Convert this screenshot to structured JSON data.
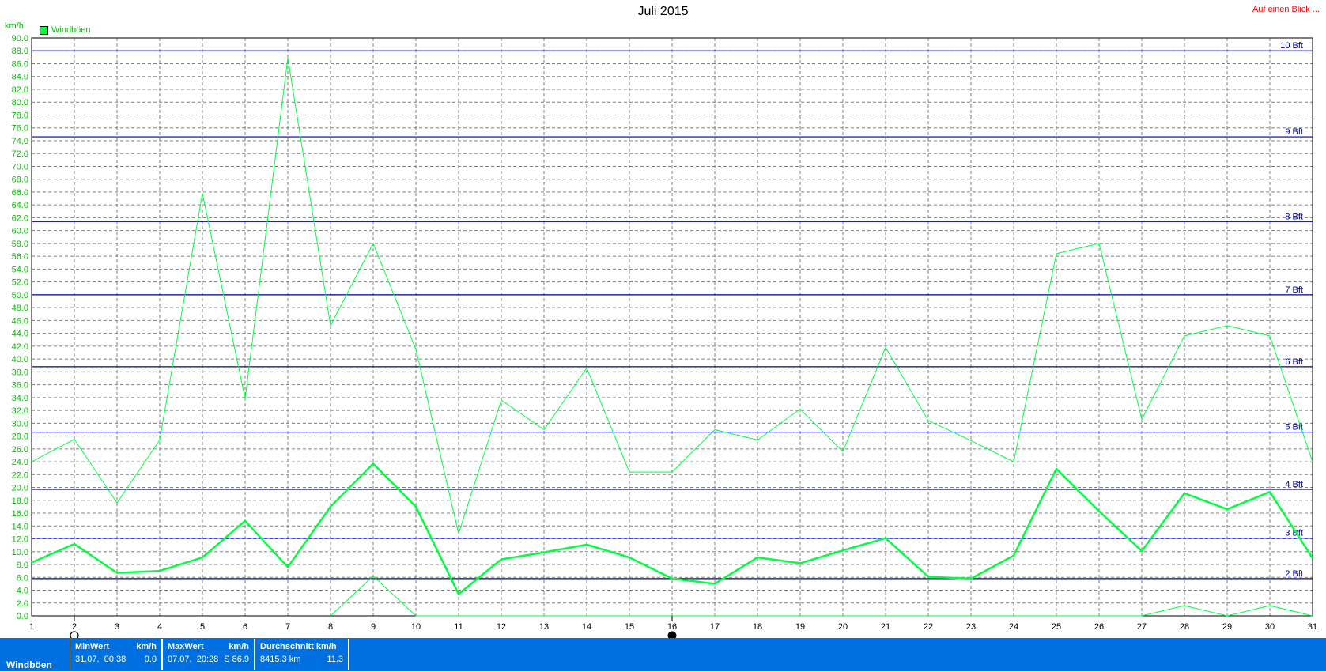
{
  "header": {
    "title": "Juli 2015",
    "link": "Auf einen Blick ...",
    "unit": "km/h",
    "legend_label": "Windböen"
  },
  "colors": {
    "grid": "#808080",
    "axis_text": "#00c000",
    "beaufort": "#0000a0",
    "series": "#00ff40",
    "footer": "#0070e0"
  },
  "chart_data": {
    "type": "line",
    "title": "Juli 2015",
    "ylabel": "km/h",
    "xlim": [
      1,
      31
    ],
    "ylim": [
      0,
      90
    ],
    "y_tick_step": 2,
    "x_ticks": [
      1,
      2,
      3,
      4,
      5,
      6,
      7,
      8,
      9,
      10,
      11,
      12,
      13,
      14,
      15,
      16,
      17,
      18,
      19,
      20,
      21,
      22,
      23,
      24,
      25,
      26,
      27,
      28,
      29,
      30,
      31
    ],
    "beaufort_lines": [
      {
        "label": "2 Bft",
        "value": 5.8
      },
      {
        "label": "3 Bft",
        "value": 12.1
      },
      {
        "label": "4 Bft",
        "value": 19.7
      },
      {
        "label": "5 Bft",
        "value": 28.6
      },
      {
        "label": "6 Bft",
        "value": 38.8
      },
      {
        "label": "7 Bft",
        "value": 50.0
      },
      {
        "label": "8 Bft",
        "value": 61.4
      },
      {
        "label": "9 Bft",
        "value": 74.6
      },
      {
        "label": "10 Bft",
        "value": 88.0
      }
    ],
    "series": [
      {
        "name": "Windböen",
        "role": "max",
        "x": [
          1,
          2,
          3,
          4,
          5,
          6,
          7,
          8,
          9,
          10,
          11,
          12,
          13,
          14,
          15,
          16,
          17,
          18,
          19,
          20,
          21,
          22,
          23,
          24,
          25,
          26,
          27,
          28,
          29,
          30,
          31
        ],
        "values": [
          24.0,
          27.5,
          17.6,
          27.4,
          65.8,
          33.8,
          86.9,
          45.2,
          58.0,
          41.5,
          12.8,
          33.6,
          29.0,
          38.6,
          22.4,
          22.4,
          29.0,
          27.4,
          32.2,
          25.6,
          41.8,
          30.4,
          27.3,
          24.0,
          56.4,
          58.0,
          30.6,
          43.6,
          45.2,
          43.6,
          24.0
        ]
      },
      {
        "name": "",
        "role": "avg",
        "x": [
          1,
          2,
          3,
          4,
          5,
          6,
          7,
          8,
          9,
          10,
          11,
          12,
          13,
          14,
          15,
          16,
          17,
          18,
          19,
          20,
          21,
          22,
          23,
          24,
          25,
          26,
          27,
          28,
          29,
          30,
          31
        ],
        "values": [
          8.3,
          11.2,
          6.7,
          7.0,
          9.1,
          14.8,
          7.6,
          17.0,
          23.7,
          17.0,
          3.4,
          8.8,
          9.9,
          11.1,
          9.1,
          5.8,
          5.0,
          9.1,
          8.2,
          10.2,
          12.1,
          6.1,
          5.8,
          9.4,
          22.9,
          16.3,
          10.1,
          19.1,
          16.6,
          19.3,
          9.0
        ]
      },
      {
        "name": "",
        "role": "min",
        "x": [
          8,
          9,
          10,
          27,
          28,
          29,
          30,
          31
        ],
        "values": [
          0.0,
          6.2,
          0.0,
          0.0,
          1.6,
          0.0,
          1.6,
          0.0
        ]
      }
    ]
  },
  "footer": {
    "label": "Windböen",
    "min": {
      "header": "MinWert",
      "unit": "km/h",
      "date": "31.07.",
      "time": "00:38",
      "value": "0.0"
    },
    "max": {
      "header": "MaxWert",
      "unit": "km/h",
      "date": "07.07.",
      "time": "20:28",
      "value": "S 86.9"
    },
    "avg": {
      "header": "Durchschnitt km/h",
      "distance": "8415.3 km",
      "value": "11.3"
    }
  }
}
